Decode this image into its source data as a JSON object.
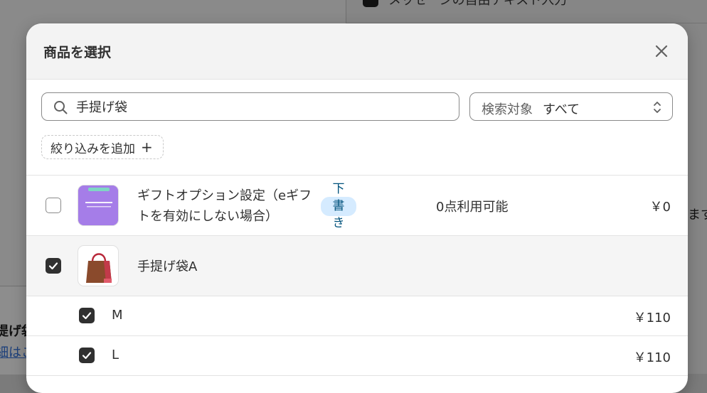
{
  "background": {
    "top_option_text": "メッセージの自由テキスト入力",
    "right_partial_text": "ます",
    "left_partial_title": "提げ袋",
    "left_partial_link": "細はこ"
  },
  "modal": {
    "title": "商品を選択",
    "search": {
      "value": "手提げ袋",
      "scope_label": "検索対象",
      "scope_value": "すべて"
    },
    "filter_button_label": "絞り込みを追加",
    "products": [
      {
        "checked": false,
        "title": "ギフトオプション設定（eギフトを有効にしない場合）",
        "status_badge": "下書き",
        "stock": "0点利用可能",
        "price": "￥0",
        "thumbnail_icon": "gift-option-thumbnail"
      },
      {
        "checked": true,
        "title": "手提げ袋A",
        "thumbnail_icon": "shopping-bag-thumbnail",
        "variants": [
          {
            "checked": true,
            "name": "M",
            "price": "￥110"
          },
          {
            "checked": true,
            "name": "L",
            "price": "￥110"
          }
        ]
      }
    ]
  },
  "colors": {
    "badge_bg": "#d5ebff",
    "badge_text": "#00527c",
    "checkbox_on": "#303030",
    "selected_row_bg": "#f5f5f5"
  }
}
